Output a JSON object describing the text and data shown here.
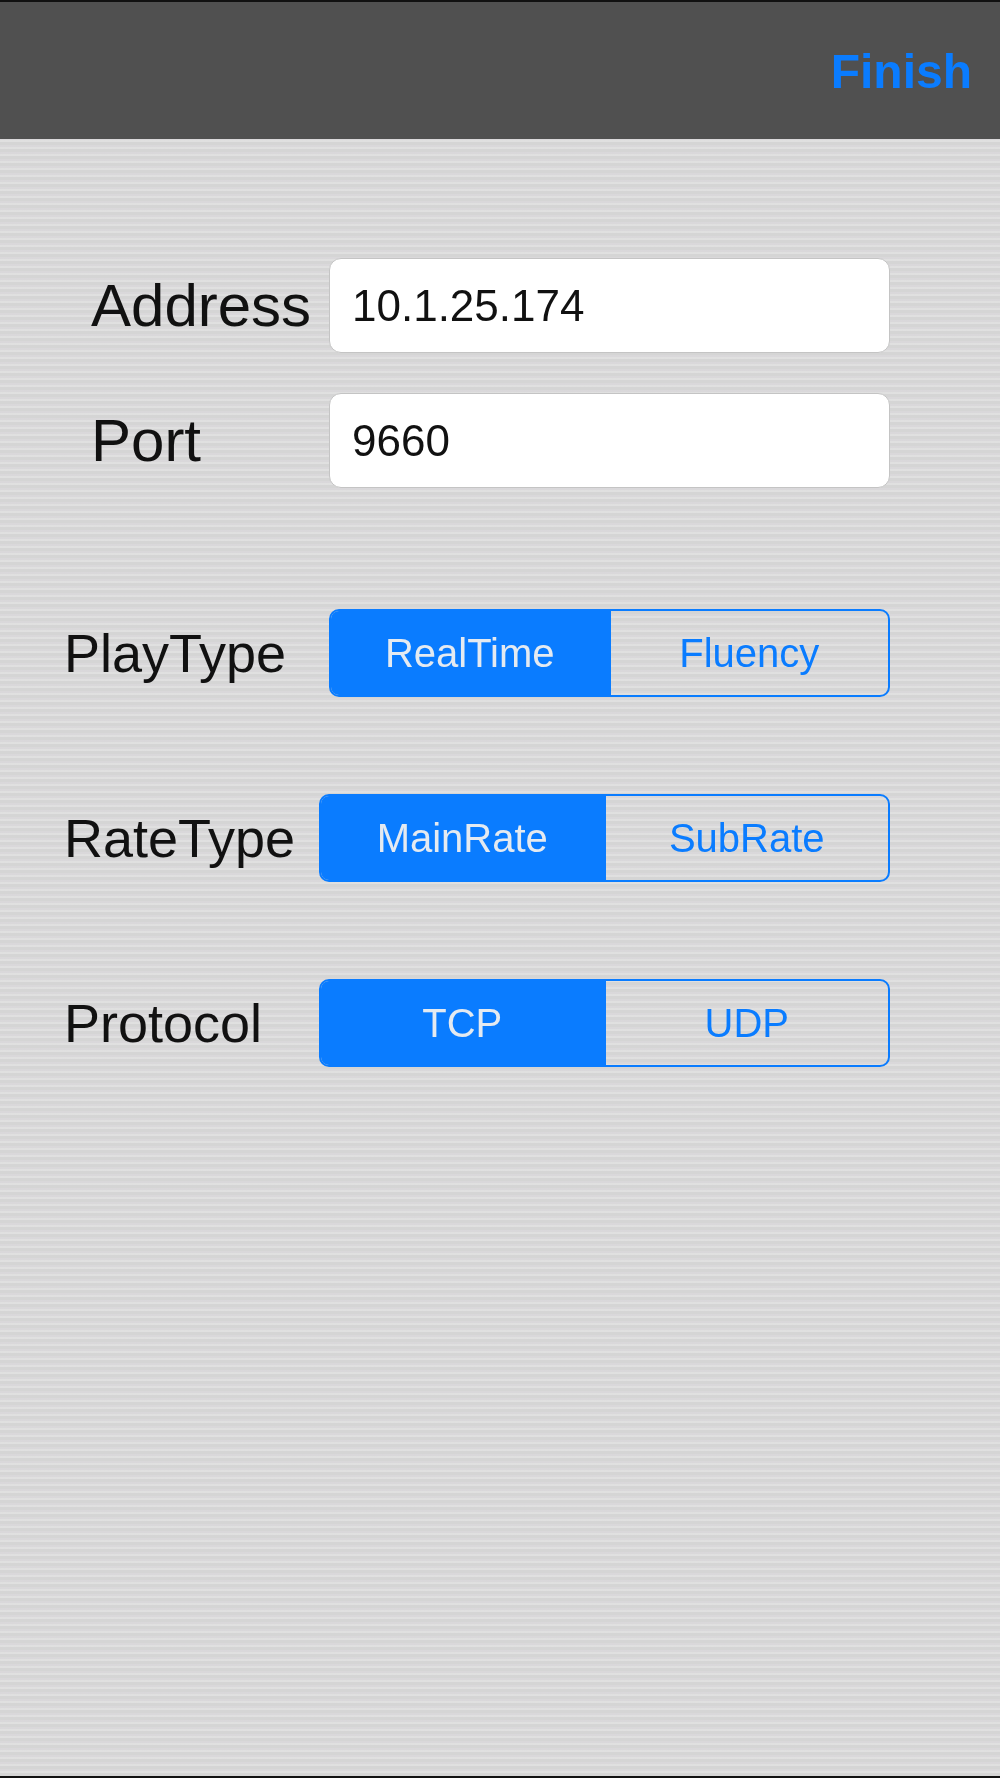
{
  "top_bar": {
    "finish_button": "Finish"
  },
  "fields": [
    {
      "label": "Address",
      "value": "10.1.25.174"
    },
    {
      "label": "Port",
      "value": "9660"
    }
  ],
  "segmented_controls": [
    {
      "label": "PlayType",
      "segments": [
        {
          "label": "RealTime",
          "selected": true
        },
        {
          "label": "Fluency",
          "selected": false
        }
      ]
    },
    {
      "label": "RateType",
      "segments": [
        {
          "label": "MainRate",
          "selected": true
        },
        {
          "label": "SubRate",
          "selected": false
        }
      ]
    },
    {
      "label": "Protocol",
      "segments": [
        {
          "label": "TCP",
          "selected": true
        },
        {
          "label": "UDP",
          "selected": false
        }
      ]
    }
  ]
}
